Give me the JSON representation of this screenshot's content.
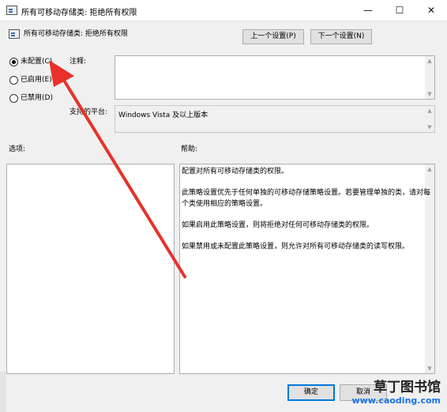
{
  "window": {
    "title": "所有可移动存储类: 拒绝所有权限",
    "minimize_glyph": "—",
    "maximize_glyph": "☐",
    "close_glyph": "✕"
  },
  "header": {
    "policy_name": "所有可移动存储类: 拒绝所有权限",
    "prev_button": "上一个设置(P)",
    "next_button": "下一个设置(N)"
  },
  "state": {
    "options": [
      {
        "label": "未配置(C)",
        "checked": true
      },
      {
        "label": "已启用(E)",
        "checked": false
      },
      {
        "label": "已禁用(D)",
        "checked": false
      }
    ]
  },
  "comment": {
    "label": "注释:",
    "value": ""
  },
  "platform": {
    "label": "支持的平台:",
    "value": "Windows Vista 及以上版本"
  },
  "options_panel": {
    "label": "选项:"
  },
  "help_panel": {
    "label": "帮助:",
    "paragraphs": [
      "配置对所有可移动存储类的权限。",
      "此策略设置优先于任何单独的可移动存储策略设置。若要管理单独的类，请对每个类使用相应的策略设置。",
      "如果启用此策略设置，则将拒绝对任何可移动存储类的权限。",
      "如果禁用或未配置此策略设置，则允许对所有可移动存储类的读写权限。"
    ]
  },
  "footer": {
    "ok_button": "确定",
    "cancel_button": "取消"
  },
  "watermark": {
    "line1": "草丁图书馆",
    "line2": "www.caoding.com"
  },
  "colors": {
    "arrow": "#e8312a",
    "accent": "#0078d7"
  }
}
